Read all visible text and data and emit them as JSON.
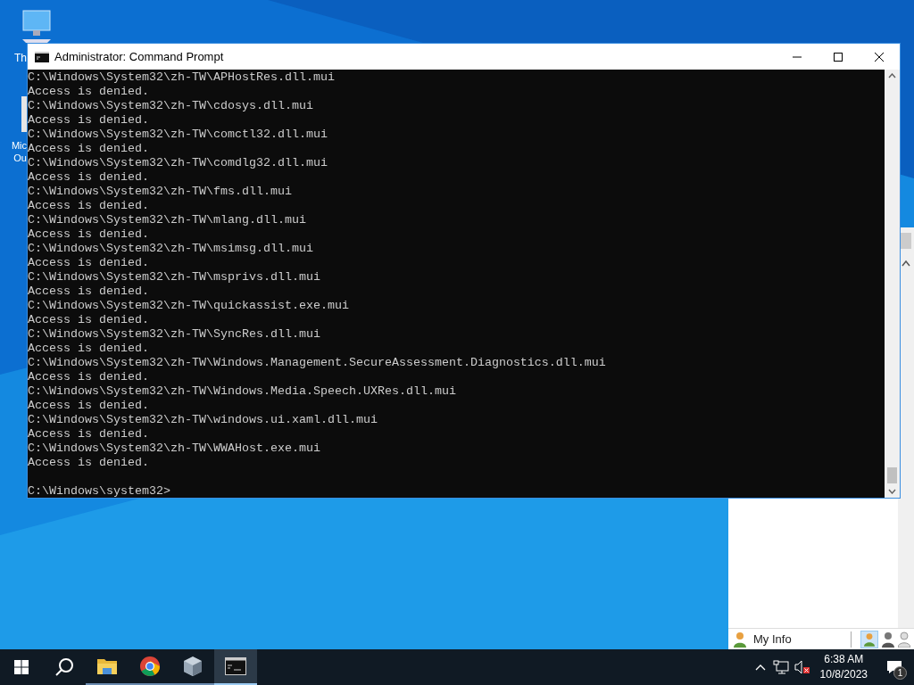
{
  "desktop_icons": [
    {
      "label": "Th"
    },
    {
      "label": "Mic\nOu"
    }
  ],
  "window": {
    "title": "Administrator: Command Prompt",
    "lines": [
      "C:\\Windows\\System32\\zh-TW\\APHostRes.dll.mui",
      "Access is denied.",
      "C:\\Windows\\System32\\zh-TW\\cdosys.dll.mui",
      "Access is denied.",
      "C:\\Windows\\System32\\zh-TW\\comctl32.dll.mui",
      "Access is denied.",
      "C:\\Windows\\System32\\zh-TW\\comdlg32.dll.mui",
      "Access is denied.",
      "C:\\Windows\\System32\\zh-TW\\fms.dll.mui",
      "Access is denied.",
      "C:\\Windows\\System32\\zh-TW\\mlang.dll.mui",
      "Access is denied.",
      "C:\\Windows\\System32\\zh-TW\\msimsg.dll.mui",
      "Access is denied.",
      "C:\\Windows\\System32\\zh-TW\\msprivs.dll.mui",
      "Access is denied.",
      "C:\\Windows\\System32\\zh-TW\\quickassist.exe.mui",
      "Access is denied.",
      "C:\\Windows\\System32\\zh-TW\\SyncRes.dll.mui",
      "Access is denied.",
      "C:\\Windows\\System32\\zh-TW\\Windows.Management.SecureAssessment.Diagnostics.dll.mui",
      "Access is denied.",
      "C:\\Windows\\System32\\zh-TW\\Windows.Media.Speech.UXRes.dll.mui",
      "Access is denied.",
      "C:\\Windows\\System32\\zh-TW\\windows.ui.xaml.dll.mui",
      "Access is denied.",
      "C:\\Windows\\System32\\zh-TW\\WWAHost.exe.mui",
      "Access is denied."
    ],
    "prompt": "C:\\Windows\\system32>"
  },
  "back_window": {
    "my_info": "My Info"
  },
  "taskbar": {
    "apps": [
      {
        "kind": "folder",
        "selected": false
      },
      {
        "kind": "chrome",
        "selected": false
      },
      {
        "kind": "box",
        "selected": false
      },
      {
        "kind": "console",
        "selected": true
      }
    ],
    "time": "6:38 AM",
    "date": "10/8/2023",
    "notifications": "1"
  }
}
